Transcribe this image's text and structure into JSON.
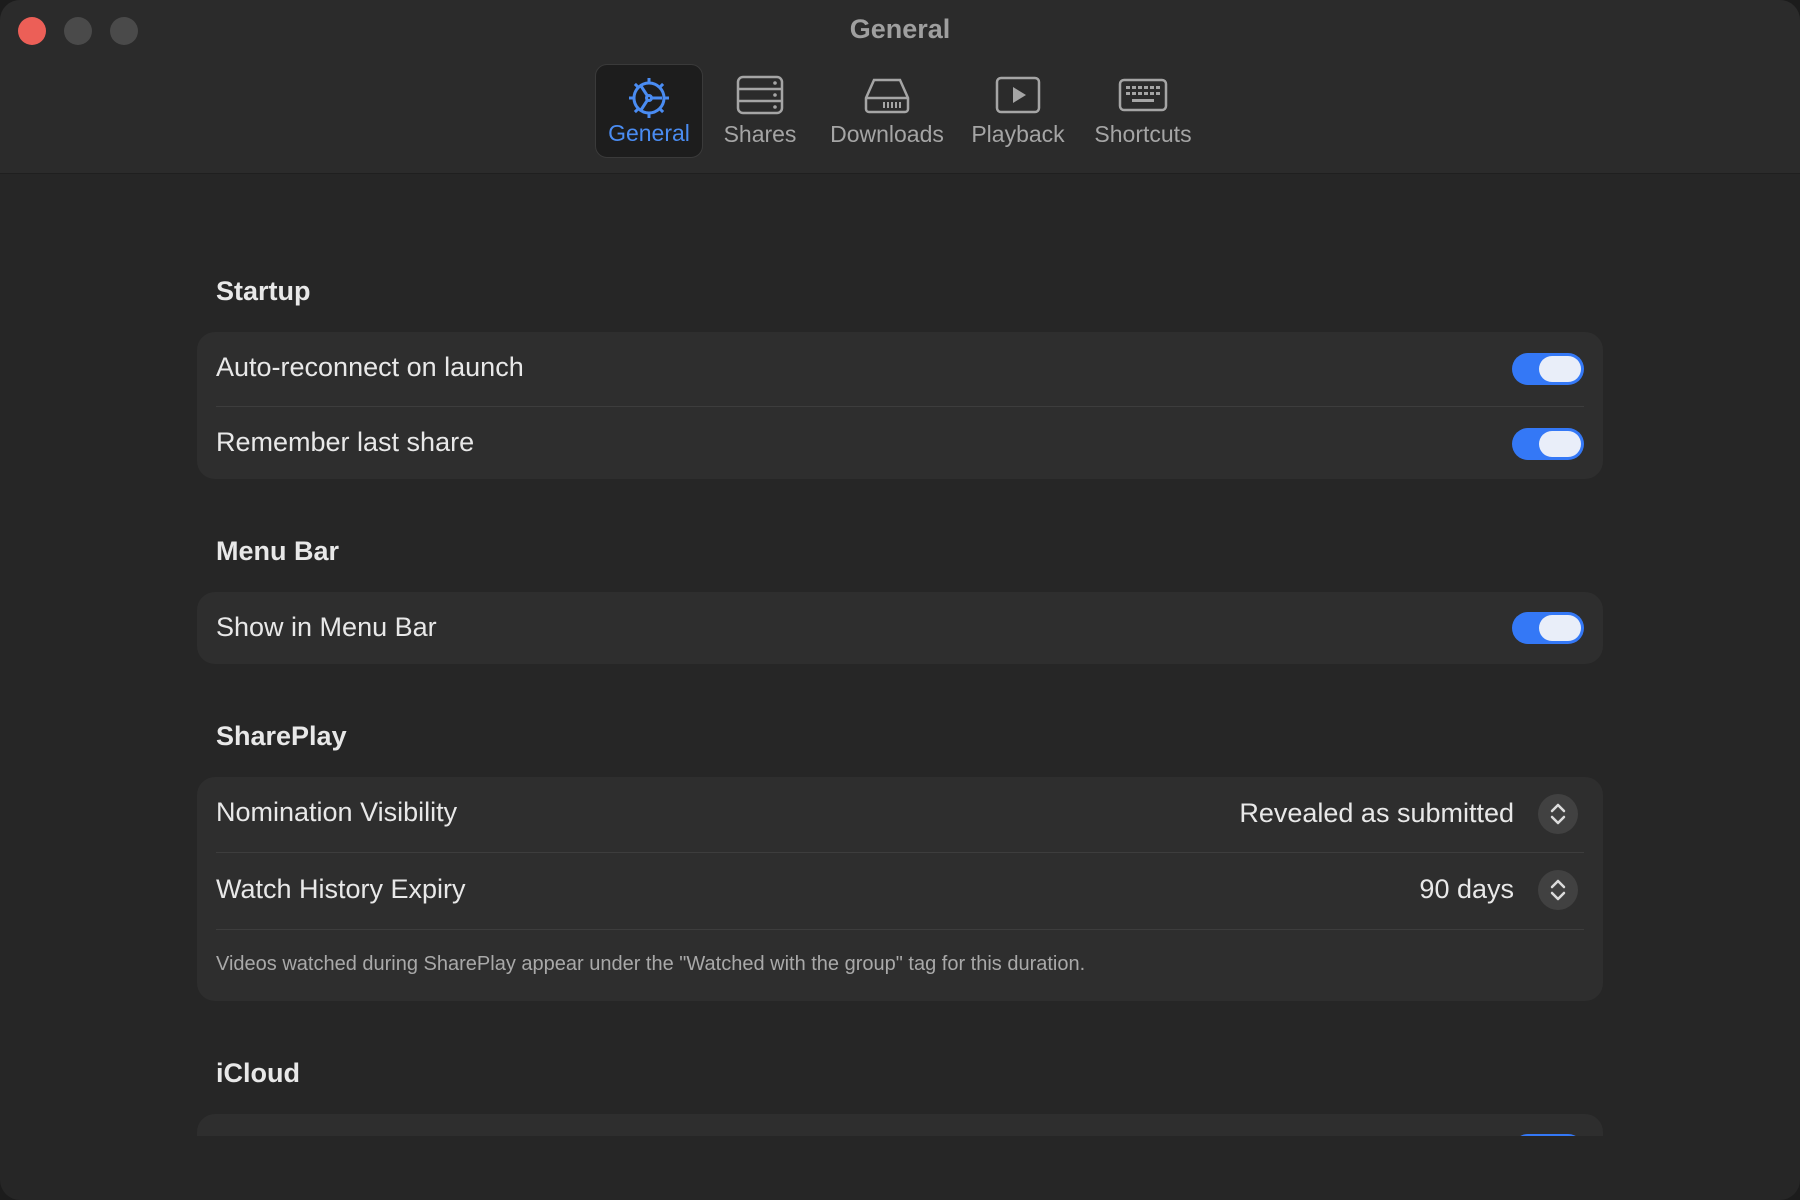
{
  "window": {
    "title": "General"
  },
  "toolbar": {
    "tabs": [
      {
        "label": "General",
        "icon": "gear-icon",
        "active": true
      },
      {
        "label": "Shares",
        "icon": "server-stack-icon",
        "active": false
      },
      {
        "label": "Downloads",
        "icon": "drive-icon",
        "active": false
      },
      {
        "label": "Playback",
        "icon": "play-icon",
        "active": false
      },
      {
        "label": "Shortcuts",
        "icon": "keyboard-icon",
        "active": false
      }
    ]
  },
  "startup": {
    "title": "Startup",
    "auto_reconnect": {
      "label": "Auto-reconnect on launch",
      "on": true
    },
    "remember_last_share": {
      "label": "Remember last share",
      "on": true
    }
  },
  "menu_bar": {
    "title": "Menu Bar",
    "show_in_menu_bar": {
      "label": "Show in Menu Bar",
      "on": true
    }
  },
  "shareplay": {
    "title": "SharePlay",
    "nomination_visibility": {
      "label": "Nomination Visibility",
      "value": "Revealed as submitted"
    },
    "watch_history_expiry": {
      "label": "Watch History Expiry",
      "value": "90 days"
    },
    "note": "Videos watched during SharePlay appear under the \"Watched with the group\" tag for this duration."
  },
  "icloud": {
    "title": "iCloud"
  },
  "colors": {
    "accent": "#3478f6",
    "active_tab": "#4a8cf2",
    "close_button": "#ec5f57"
  }
}
